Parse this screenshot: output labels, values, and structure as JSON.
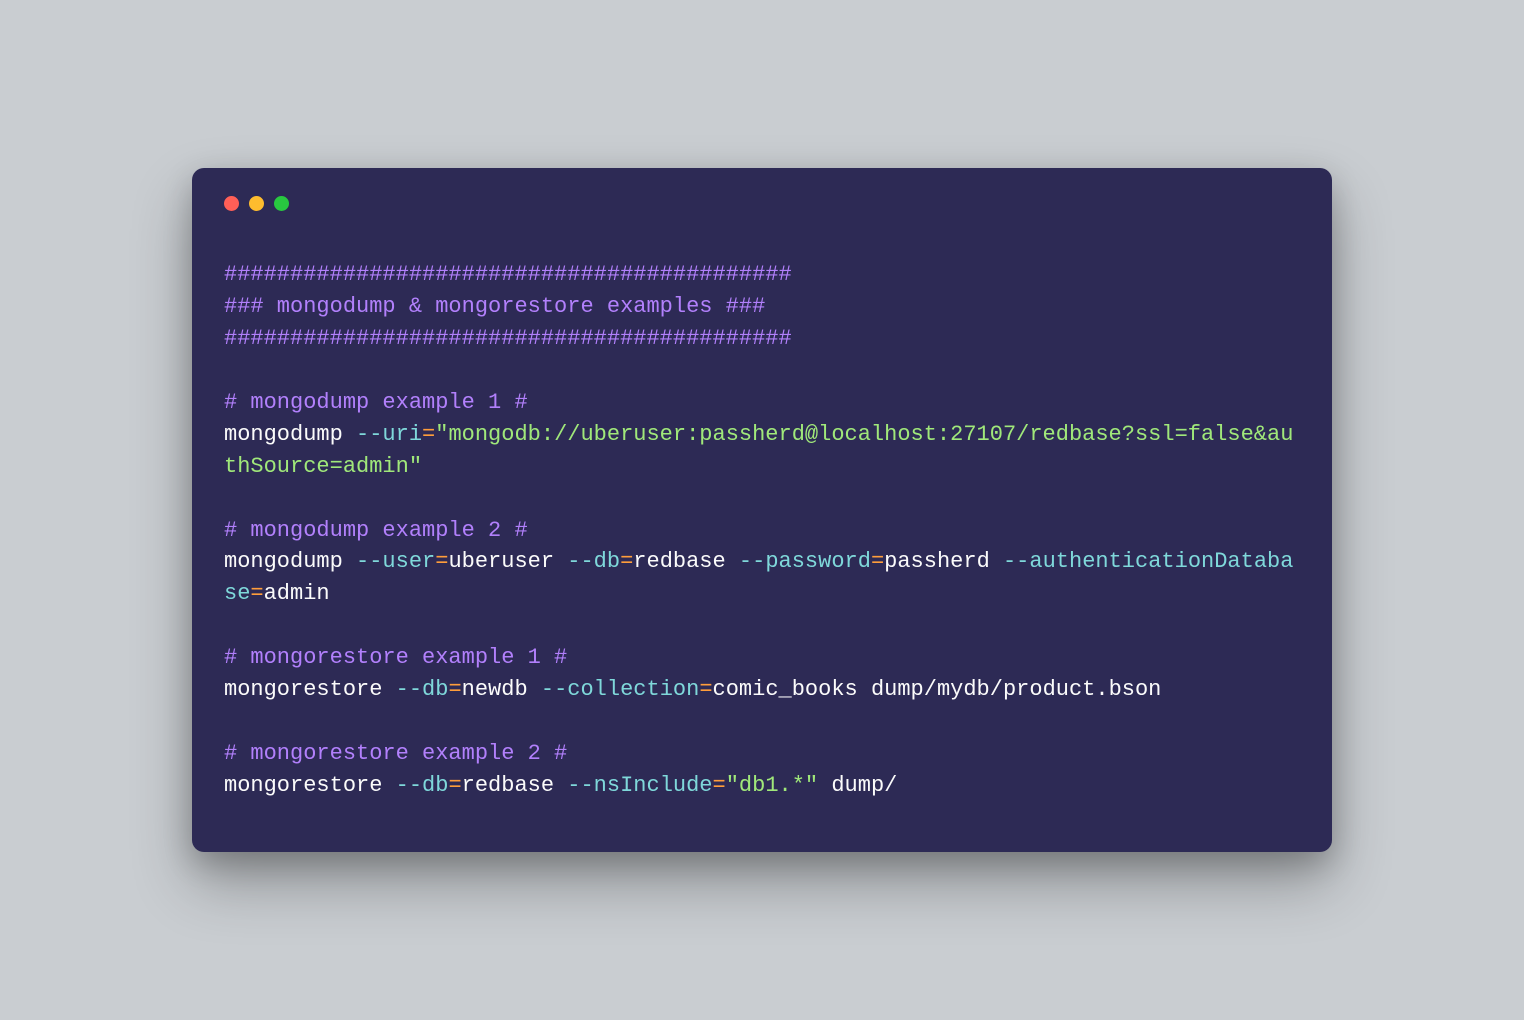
{
  "header": {
    "divider": "###########################################",
    "title": "### mongodump & mongorestore examples ###"
  },
  "section1": {
    "comment": "# mongodump example 1 #",
    "cmd": "mongodump ",
    "flag": "--uri",
    "eq": "=",
    "str": "\"mongodb://uberuser:passherd@localhost:27107/redbase?ssl=false&authSource=admin\""
  },
  "section2": {
    "comment": "# mongodump example 2 #",
    "cmd": "mongodump ",
    "flag1": "--user",
    "eq": "=",
    "val1": "uberuser ",
    "flag2": "--db",
    "val2": "redbase ",
    "flag3": "--password",
    "val3": "passherd ",
    "flag4": "--authenticationDatabase",
    "val4": "admin"
  },
  "section3": {
    "comment": "# mongorestore example 1 #",
    "cmd": "mongorestore ",
    "flag1": "--db",
    "eq": "=",
    "val1": "newdb ",
    "flag2": "--collection",
    "val2": "comic_books dump/mydb/product.bson"
  },
  "section4": {
    "comment": "# mongorestore example 2 #",
    "cmd": "mongorestore ",
    "flag1": "--db",
    "eq": "=",
    "val1": "redbase ",
    "flag2": "--nsInclude",
    "str": "\"db1.*\"",
    "tail": " dump/"
  }
}
